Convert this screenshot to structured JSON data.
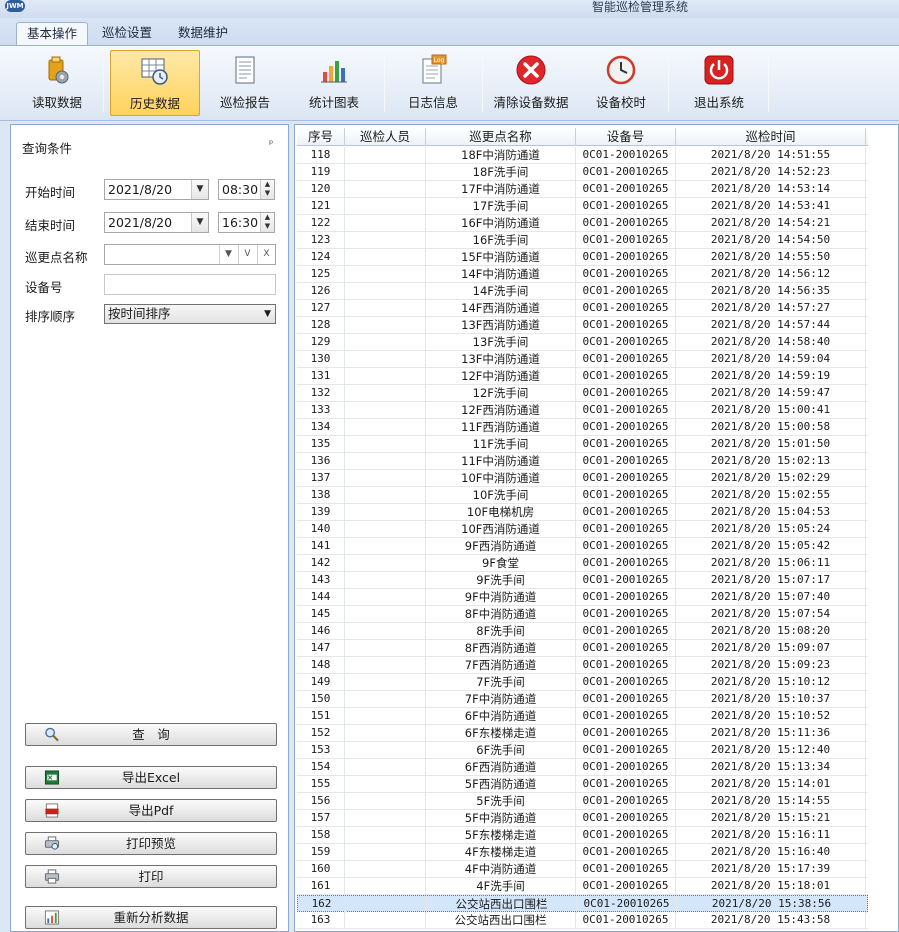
{
  "window": {
    "title": "智能巡检管理系统",
    "app_icon": "JWM"
  },
  "tabs": [
    {
      "label": "基本操作",
      "active": true
    },
    {
      "label": "巡检设置",
      "active": false
    },
    {
      "label": "数据维护",
      "active": false
    }
  ],
  "ribbon": [
    {
      "label": "读取数据",
      "icon": "read-data-icon"
    },
    {
      "label": "历史数据",
      "icon": "history-data-icon",
      "active": true
    },
    {
      "label": "巡检报告",
      "icon": "report-icon"
    },
    {
      "label": "统计图表",
      "icon": "chart-icon"
    },
    {
      "label": "日志信息",
      "icon": "log-icon",
      "badge": "Log"
    },
    {
      "label": "清除设备数据",
      "icon": "clear-icon"
    },
    {
      "label": "设备校时",
      "icon": "clock-icon"
    },
    {
      "label": "退出系统",
      "icon": "power-icon"
    }
  ],
  "query": {
    "title": "查询条件",
    "start_label": "开始时间",
    "start_date": "2021/8/20",
    "start_time": "08:30",
    "end_label": "结束时间",
    "end_date": "2021/8/20",
    "end_time": "16:30",
    "point_label": "巡更点名称",
    "point_value": "",
    "v_btn": "V",
    "x_btn": "X",
    "device_label": "设备号",
    "device_value": "",
    "sort_label": "排序顺序",
    "sort_value": "按时间排序"
  },
  "actions": [
    {
      "label": "查　询",
      "icon": "search-icon"
    },
    {
      "label": "导出Excel",
      "icon": "excel-icon"
    },
    {
      "label": "导出Pdf",
      "icon": "pdf-icon"
    },
    {
      "label": "打印预览",
      "icon": "print-preview-icon"
    },
    {
      "label": "打印",
      "icon": "printer-icon"
    },
    {
      "label": "重新分析数据",
      "icon": "reanalyze-icon"
    }
  ],
  "grid": {
    "columns": [
      "序号",
      "巡检人员",
      "巡更点名称",
      "设备号",
      "巡检时间"
    ],
    "selected_row": "162",
    "rows": [
      [
        "118",
        "",
        "18F中消防通道",
        "0C01-20010265",
        "2021/8/20 14:51:55"
      ],
      [
        "119",
        "",
        "18F洗手间",
        "0C01-20010265",
        "2021/8/20 14:52:23"
      ],
      [
        "120",
        "",
        "17F中消防通道",
        "0C01-20010265",
        "2021/8/20 14:53:14"
      ],
      [
        "121",
        "",
        "17F洗手间",
        "0C01-20010265",
        "2021/8/20 14:53:41"
      ],
      [
        "122",
        "",
        "16F中消防通道",
        "0C01-20010265",
        "2021/8/20 14:54:21"
      ],
      [
        "123",
        "",
        "16F洗手间",
        "0C01-20010265",
        "2021/8/20 14:54:50"
      ],
      [
        "124",
        "",
        "15F中消防通道",
        "0C01-20010265",
        "2021/8/20 14:55:50"
      ],
      [
        "125",
        "",
        "14F中消防通道",
        "0C01-20010265",
        "2021/8/20 14:56:12"
      ],
      [
        "126",
        "",
        "14F洗手间",
        "0C01-20010265",
        "2021/8/20 14:56:35"
      ],
      [
        "127",
        "",
        "14F西消防通道",
        "0C01-20010265",
        "2021/8/20 14:57:27"
      ],
      [
        "128",
        "",
        "13F西消防通道",
        "0C01-20010265",
        "2021/8/20 14:57:44"
      ],
      [
        "129",
        "",
        "13F洗手间",
        "0C01-20010265",
        "2021/8/20 14:58:40"
      ],
      [
        "130",
        "",
        "13F中消防通道",
        "0C01-20010265",
        "2021/8/20 14:59:04"
      ],
      [
        "131",
        "",
        "12F中消防通道",
        "0C01-20010265",
        "2021/8/20 14:59:19"
      ],
      [
        "132",
        "",
        "12F洗手间",
        "0C01-20010265",
        "2021/8/20 14:59:47"
      ],
      [
        "133",
        "",
        "12F西消防通道",
        "0C01-20010265",
        "2021/8/20 15:00:41"
      ],
      [
        "134",
        "",
        "11F西消防通道",
        "0C01-20010265",
        "2021/8/20 15:00:58"
      ],
      [
        "135",
        "",
        "11F洗手间",
        "0C01-20010265",
        "2021/8/20 15:01:50"
      ],
      [
        "136",
        "",
        "11F中消防通道",
        "0C01-20010265",
        "2021/8/20 15:02:13"
      ],
      [
        "137",
        "",
        "10F中消防通道",
        "0C01-20010265",
        "2021/8/20 15:02:29"
      ],
      [
        "138",
        "",
        "10F洗手间",
        "0C01-20010265",
        "2021/8/20 15:02:55"
      ],
      [
        "139",
        "",
        "10F电梯机房",
        "0C01-20010265",
        "2021/8/20 15:04:53"
      ],
      [
        "140",
        "",
        "10F西消防通道",
        "0C01-20010265",
        "2021/8/20 15:05:24"
      ],
      [
        "141",
        "",
        "9F西消防通道",
        "0C01-20010265",
        "2021/8/20 15:05:42"
      ],
      [
        "142",
        "",
        "9F食堂",
        "0C01-20010265",
        "2021/8/20 15:06:11"
      ],
      [
        "143",
        "",
        "9F洗手间",
        "0C01-20010265",
        "2021/8/20 15:07:17"
      ],
      [
        "144",
        "",
        "9F中消防通道",
        "0C01-20010265",
        "2021/8/20 15:07:40"
      ],
      [
        "145",
        "",
        "8F中消防通道",
        "0C01-20010265",
        "2021/8/20 15:07:54"
      ],
      [
        "146",
        "",
        "8F洗手间",
        "0C01-20010265",
        "2021/8/20 15:08:20"
      ],
      [
        "147",
        "",
        "8F西消防通道",
        "0C01-20010265",
        "2021/8/20 15:09:07"
      ],
      [
        "148",
        "",
        "7F西消防通道",
        "0C01-20010265",
        "2021/8/20 15:09:23"
      ],
      [
        "149",
        "",
        "7F洗手间",
        "0C01-20010265",
        "2021/8/20 15:10:12"
      ],
      [
        "150",
        "",
        "7F中消防通道",
        "0C01-20010265",
        "2021/8/20 15:10:37"
      ],
      [
        "151",
        "",
        "6F中消防通道",
        "0C01-20010265",
        "2021/8/20 15:10:52"
      ],
      [
        "152",
        "",
        "6F东楼梯走道",
        "0C01-20010265",
        "2021/8/20 15:11:36"
      ],
      [
        "153",
        "",
        "6F洗手间",
        "0C01-20010265",
        "2021/8/20 15:12:40"
      ],
      [
        "154",
        "",
        "6F西消防通道",
        "0C01-20010265",
        "2021/8/20 15:13:34"
      ],
      [
        "155",
        "",
        "5F西消防通道",
        "0C01-20010265",
        "2021/8/20 15:14:01"
      ],
      [
        "156",
        "",
        "5F洗手间",
        "0C01-20010265",
        "2021/8/20 15:14:55"
      ],
      [
        "157",
        "",
        "5F中消防通道",
        "0C01-20010265",
        "2021/8/20 15:15:21"
      ],
      [
        "158",
        "",
        "5F东楼梯走道",
        "0C01-20010265",
        "2021/8/20 15:16:11"
      ],
      [
        "159",
        "",
        "4F东楼梯走道",
        "0C01-20010265",
        "2021/8/20 15:16:40"
      ],
      [
        "160",
        "",
        "4F中消防通道",
        "0C01-20010265",
        "2021/8/20 15:17:39"
      ],
      [
        "161",
        "",
        "4F洗手间",
        "0C01-20010265",
        "2021/8/20 15:18:01"
      ],
      [
        "162",
        "",
        "公交站西出口围栏",
        "0C01-20010265",
        "2021/8/20 15:38:56"
      ],
      [
        "163",
        "",
        "公交站西出口围栏",
        "0C01-20010265",
        "2021/8/20 15:43:58"
      ]
    ]
  }
}
